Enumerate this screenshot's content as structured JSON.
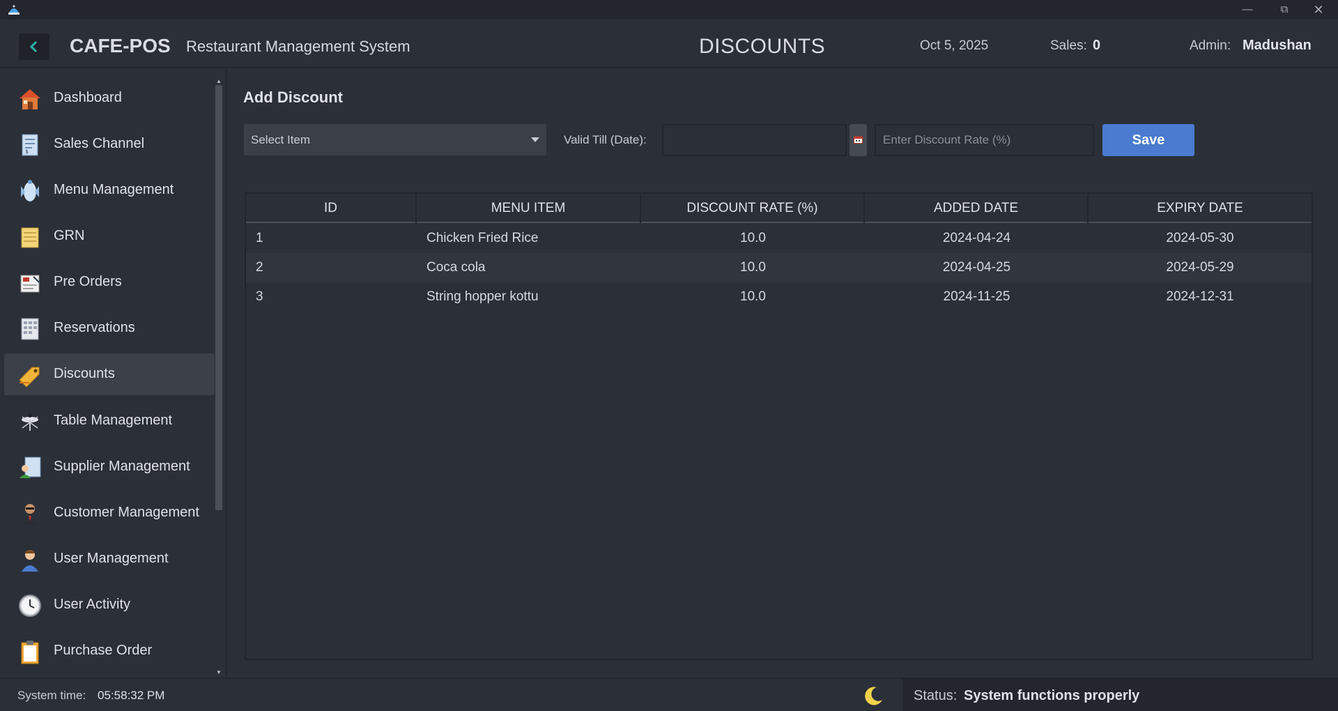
{
  "app": {
    "brand": "CAFE-POS",
    "subtitle": "Restaurant Management System",
    "page_title": "DISCOUNTS",
    "date": "Oct 5, 2025",
    "sales_label": "Sales:",
    "sales_value": "0",
    "admin_label": "Admin:",
    "admin_value": "Madushan"
  },
  "sidebar": {
    "items": [
      {
        "label": "Dashboard",
        "icon": "house-icon"
      },
      {
        "label": "Sales Channel",
        "icon": "document-icon"
      },
      {
        "label": "Menu Management",
        "icon": "menu-icon"
      },
      {
        "label": "GRN",
        "icon": "notepad-icon"
      },
      {
        "label": "Pre Orders",
        "icon": "order-form-icon"
      },
      {
        "label": "Reservations",
        "icon": "calendar-sheet-icon"
      },
      {
        "label": "Discounts",
        "icon": "tag-icon"
      },
      {
        "label": "Table Management",
        "icon": "table-icon"
      },
      {
        "label": "Supplier Management",
        "icon": "supplier-icon"
      },
      {
        "label": "Customer Management",
        "icon": "customer-icon"
      },
      {
        "label": "User Management",
        "icon": "user-icon"
      },
      {
        "label": "User Activity",
        "icon": "clock-icon"
      },
      {
        "label": "Purchase Order",
        "icon": "clipboard-icon"
      }
    ],
    "active": "Discounts"
  },
  "form": {
    "section_title": "Add Discount",
    "select_item": "Select Item",
    "valid_till_label": "Valid Till (Date):",
    "date_value": "",
    "rate_placeholder": "Enter Discount Rate (%)",
    "save_label": "Save"
  },
  "table": {
    "columns": [
      "ID",
      "MENU ITEM",
      "DISCOUNT RATE (%)",
      "ADDED DATE",
      "EXPIRY DATE"
    ],
    "rows": [
      [
        "1",
        "Chicken Fried Rice",
        "10.0",
        "2024-04-24",
        "2024-05-30"
      ],
      [
        "2",
        "Coca cola",
        "10.0",
        "2024-04-25",
        "2024-05-29"
      ],
      [
        "3",
        "String hopper kottu",
        "10.0",
        "2024-11-25",
        "2024-12-31"
      ]
    ]
  },
  "footer": {
    "system_time_label": "System time:",
    "system_time_value": "05:58:32 PM",
    "status_label": "Status:",
    "status_value": "System functions properly"
  },
  "colors": {
    "accent": "#4a7bd0",
    "back_arrow": "#2bb5a8",
    "background": "#2b2f38",
    "moon": "#f2d24a"
  }
}
